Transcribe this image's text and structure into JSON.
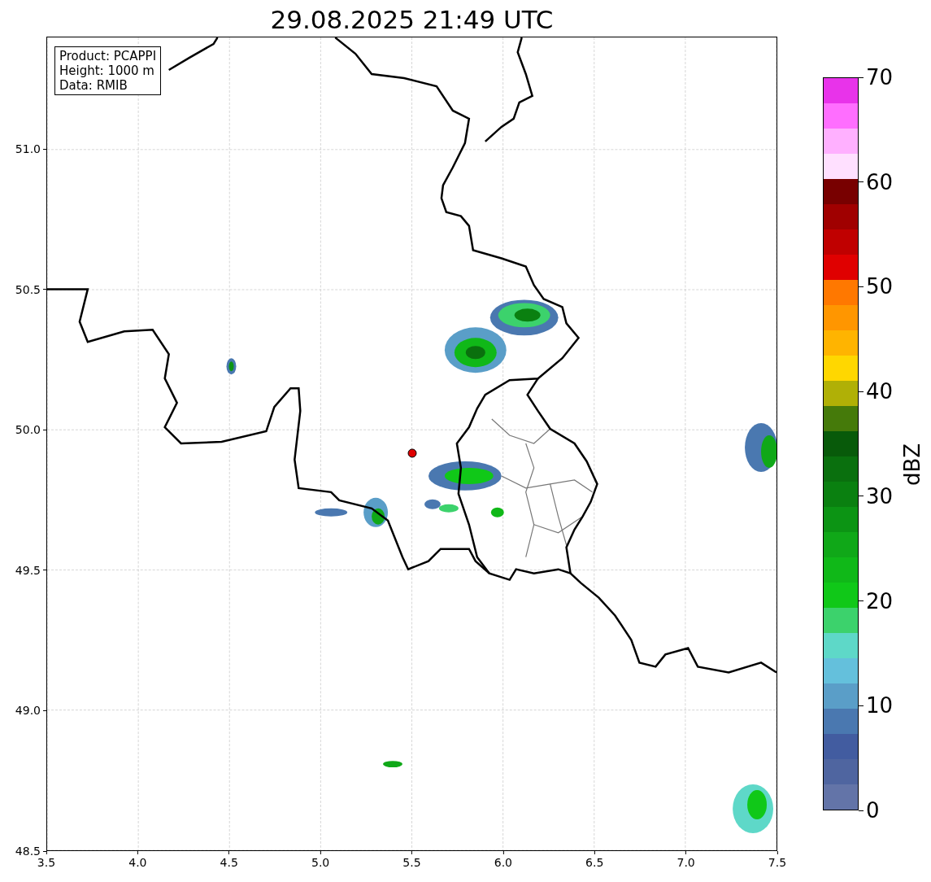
{
  "title": "29.08.2025 21:49 UTC",
  "info_box": [
    "Product: PCAPPI",
    "Height: 1000 m",
    "Data: RMIB"
  ],
  "x_axis": {
    "ticks": [
      "3.5",
      "4.0",
      "4.5",
      "5.0",
      "5.5",
      "6.0",
      "6.5",
      "7.0",
      "7.5"
    ]
  },
  "y_axis": {
    "ticks": [
      "51.0",
      "50.5",
      "50.0",
      "49.5",
      "49.0",
      "48.5"
    ]
  },
  "colorbar": {
    "label": "dBZ",
    "ticks": [
      "70",
      "60",
      "50",
      "40",
      "30",
      "20",
      "10",
      "0"
    ],
    "segments": [
      {
        "color": "#6374a8"
      },
      {
        "color": "#4f65a0"
      },
      {
        "color": "#425ca0"
      },
      {
        "color": "#4a78b0"
      },
      {
        "color": "#5a9ec8"
      },
      {
        "color": "#64c0dc"
      },
      {
        "color": "#5ed8c8"
      },
      {
        "color": "#3cd26c"
      },
      {
        "color": "#10c818"
      },
      {
        "color": "#10b818"
      },
      {
        "color": "#10a818"
      },
      {
        "color": "#0c9414"
      },
      {
        "color": "#0a8010"
      },
      {
        "color": "#0a700e"
      },
      {
        "color": "#085a0a"
      },
      {
        "color": "#457a0a"
      },
      {
        "color": "#b0b006"
      },
      {
        "color": "#ffd700"
      },
      {
        "color": "#ffb400"
      },
      {
        "color": "#ff9600"
      },
      {
        "color": "#ff7800"
      },
      {
        "color": "#e00000"
      },
      {
        "color": "#c00000"
      },
      {
        "color": "#a00000"
      },
      {
        "color": "#780000"
      },
      {
        "color": "#ffe0ff"
      },
      {
        "color": "#ffb0ff"
      },
      {
        "color": "#ff6eff"
      },
      {
        "color": "#e833ea"
      }
    ]
  }
}
